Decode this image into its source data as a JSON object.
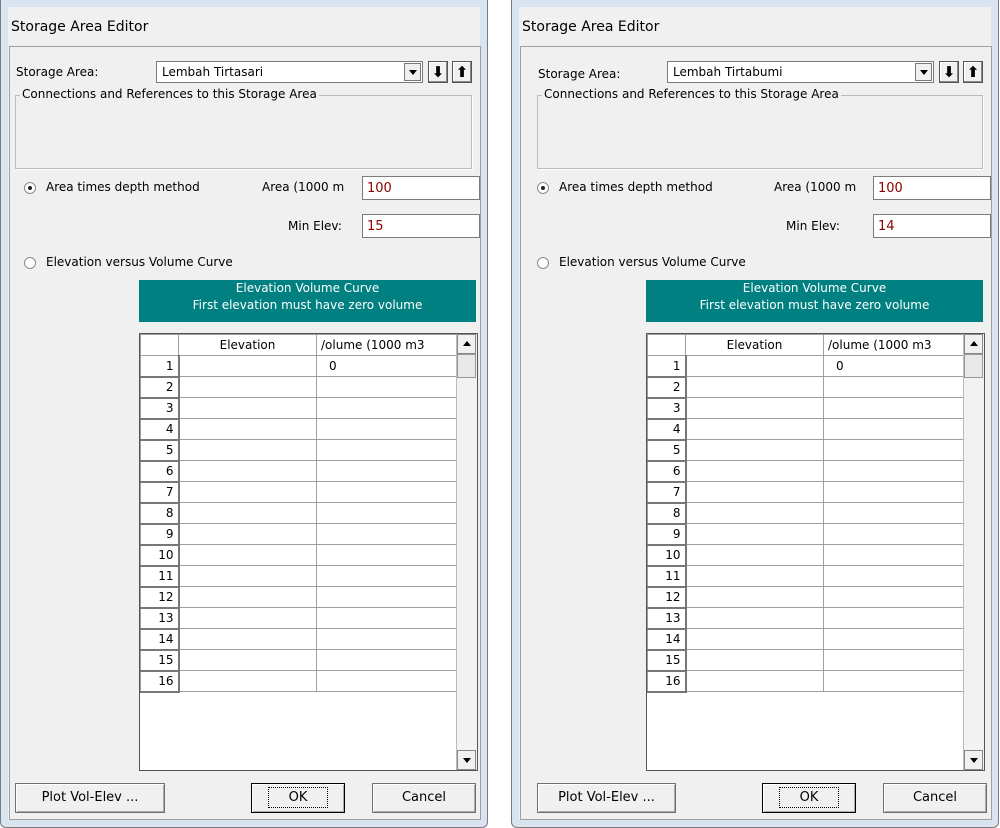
{
  "windows": [
    {
      "title": "Storage Area Editor",
      "storage_area_label": "Storage Area:",
      "storage_area_value": "Lembah Tirtasari",
      "down_arrow": "⬇",
      "up_arrow": "⬆",
      "connections_legend": "Connections and References to this Storage Area",
      "method_area_label": "Area times depth method",
      "area_label": "Area (1000 m",
      "area_value": "100",
      "min_elev_label": "Min Elev:",
      "min_elev_value": "15",
      "method_curve_label": "Elevation versus Volume Curve",
      "banner_line1": "Elevation Volume Curve",
      "banner_line2": "First elevation must have zero volume",
      "col_elevation": "Elevation",
      "col_volume": "/olume (1000 m3",
      "first_volume": "0",
      "plot_button": "Plot Vol-Elev ...",
      "ok_button": "OK",
      "cancel_button": "Cancel"
    },
    {
      "title": "Storage Area Editor",
      "storage_area_label": "Storage Area:",
      "storage_area_value": "Lembah Tirtabumi",
      "down_arrow": "⬇",
      "up_arrow": "⬆",
      "connections_legend": "Connections and References to this Storage Area",
      "method_area_label": "Area times depth method",
      "area_label": "Area (1000 m",
      "area_value": "100",
      "min_elev_label": "Min Elev:",
      "min_elev_value": "14",
      "method_curve_label": "Elevation versus Volume Curve",
      "banner_line1": "Elevation Volume Curve",
      "banner_line2": "First elevation must have zero volume",
      "col_elevation": "Elevation",
      "col_volume": "/olume (1000 m3",
      "first_volume": "0",
      "plot_button": "Plot Vol-Elev ...",
      "ok_button": "OK",
      "cancel_button": "Cancel"
    }
  ],
  "row_numbers": [
    "1",
    "2",
    "3",
    "4",
    "5",
    "6",
    "7",
    "8",
    "9",
    "10",
    "11",
    "12",
    "13",
    "14",
    "15",
    "16"
  ],
  "colors": {
    "banner": "#008080",
    "input_text": "#8b0000"
  }
}
